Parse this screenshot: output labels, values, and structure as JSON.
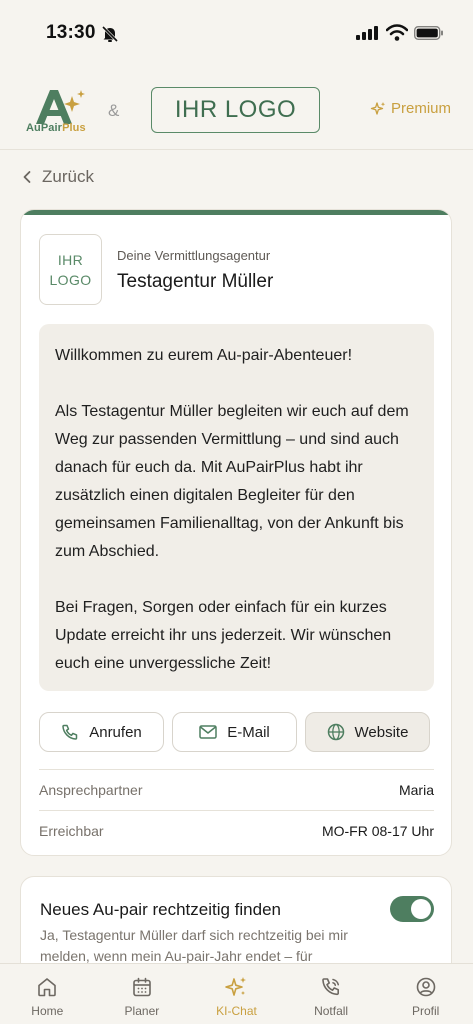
{
  "status_bar": {
    "time": "13:30"
  },
  "header": {
    "brand_text": "AuPair",
    "brand_text_accent": "Plus",
    "separator": "&",
    "logo_placeholder": "IHR LOGO",
    "premium_label": "Premium"
  },
  "nav": {
    "back_label": "Zurück"
  },
  "agency": {
    "logo_line1": "IHR",
    "logo_line2": "LOGO",
    "kicker": "Deine Vermittlungsagentur",
    "name": "Testagentur Müller",
    "welcome": [
      "Willkommen zu eurem Au-pair-Abenteuer!",
      "Als Testagentur Müller begleiten wir euch auf dem Weg zur passenden Vermittlung – und sind auch danach für euch da. Mit AuPairPlus habt ihr zusätzlich einen digitalen Begleiter für den gemeinsamen Familienalltag, von der Ankunft bis zum Abschied.",
      "Bei Fragen, Sorgen oder einfach für ein kurzes Update erreicht ihr uns jederzeit. Wir wünschen euch eine unvergessliche Zeit!"
    ],
    "actions": {
      "call": "Anrufen",
      "email": "E-Mail",
      "website": "Website"
    },
    "contact_label": "Ansprechpartner",
    "contact_value": "Maria",
    "hours_label": "Erreichbar",
    "hours_value": "MO-FR 08-17 Uhr"
  },
  "rematch": {
    "title": "Neues Au-pair rechtzeitig finden",
    "description": "Ja, Testagentur Müller darf sich rechtzeitig bei mir melden, wenn mein Au-pair-Jahr endet – für",
    "toggle_on": true
  },
  "tabbar": {
    "home": "Home",
    "planer": "Planer",
    "chat": "KI-Chat",
    "notfall": "Notfall",
    "profil": "Profil"
  },
  "colors": {
    "brand_green": "#4e7e60",
    "accent_gold": "#c9a040",
    "background": "#f6f4ef"
  }
}
